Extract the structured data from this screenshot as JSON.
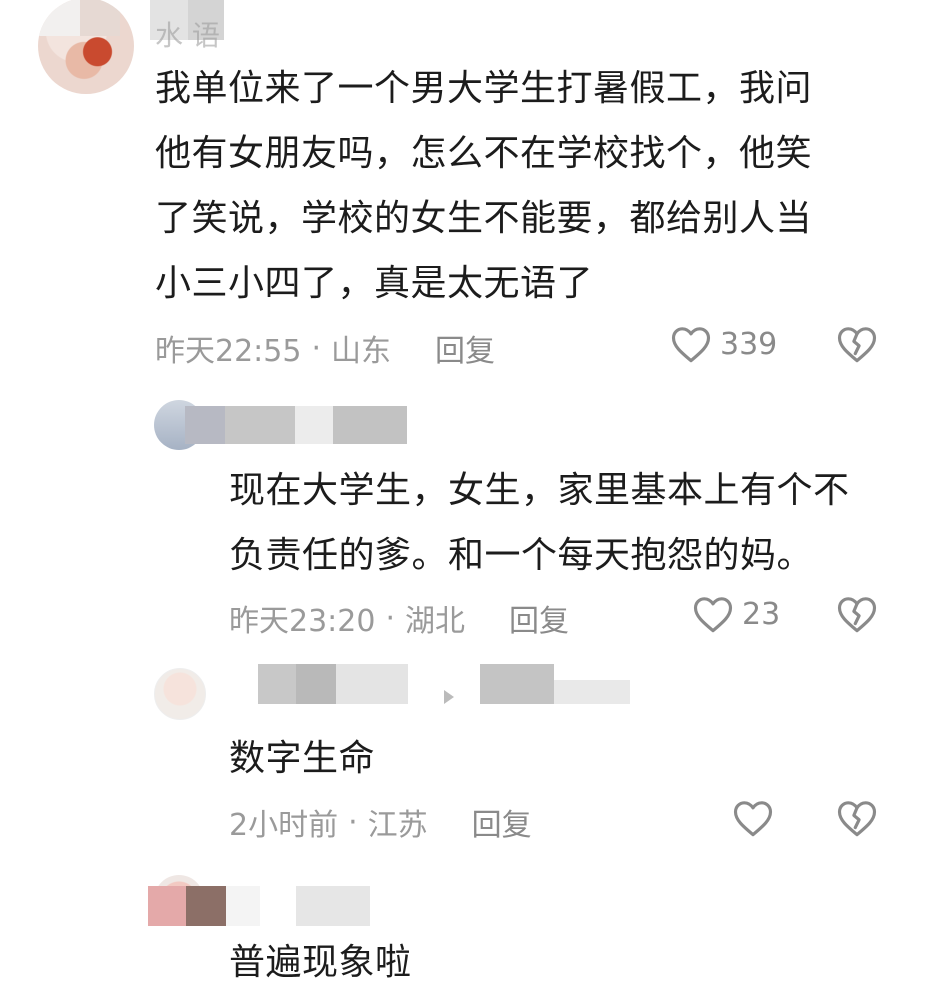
{
  "comments": [
    {
      "username": "水 语",
      "content": [
        "我单位来了一个男大学生打暑假工，我问",
        "他有女朋友吗，怎么不在学校找个，他笑",
        "了笑说，学校的女生不能要，都给别人当",
        "小三小四了，真是太无语了"
      ],
      "time": "昨天22:55",
      "location": "山东",
      "reply_label": "回复",
      "likes": "339"
    },
    {
      "content": [
        "现在大学生，女生，家里基本上有个不",
        "负责任的爹。和一个每天抱怨的妈。"
      ],
      "time": "昨天23:20",
      "location": "湖北",
      "reply_label": "回复",
      "likes": "23"
    },
    {
      "content": [
        "数字生命"
      ],
      "time": "2小时前",
      "location": "江苏",
      "reply_label": "回复",
      "likes": ""
    },
    {
      "content": [
        "普遍现象啦"
      ]
    }
  ],
  "separator": "·",
  "icons": {
    "like": "heart-outline-icon",
    "dislike": "broken-heart-icon"
  },
  "colors": {
    "text": "#1c1c1c",
    "meta": "#9a9a9a",
    "icon": "#8a8a8a"
  }
}
